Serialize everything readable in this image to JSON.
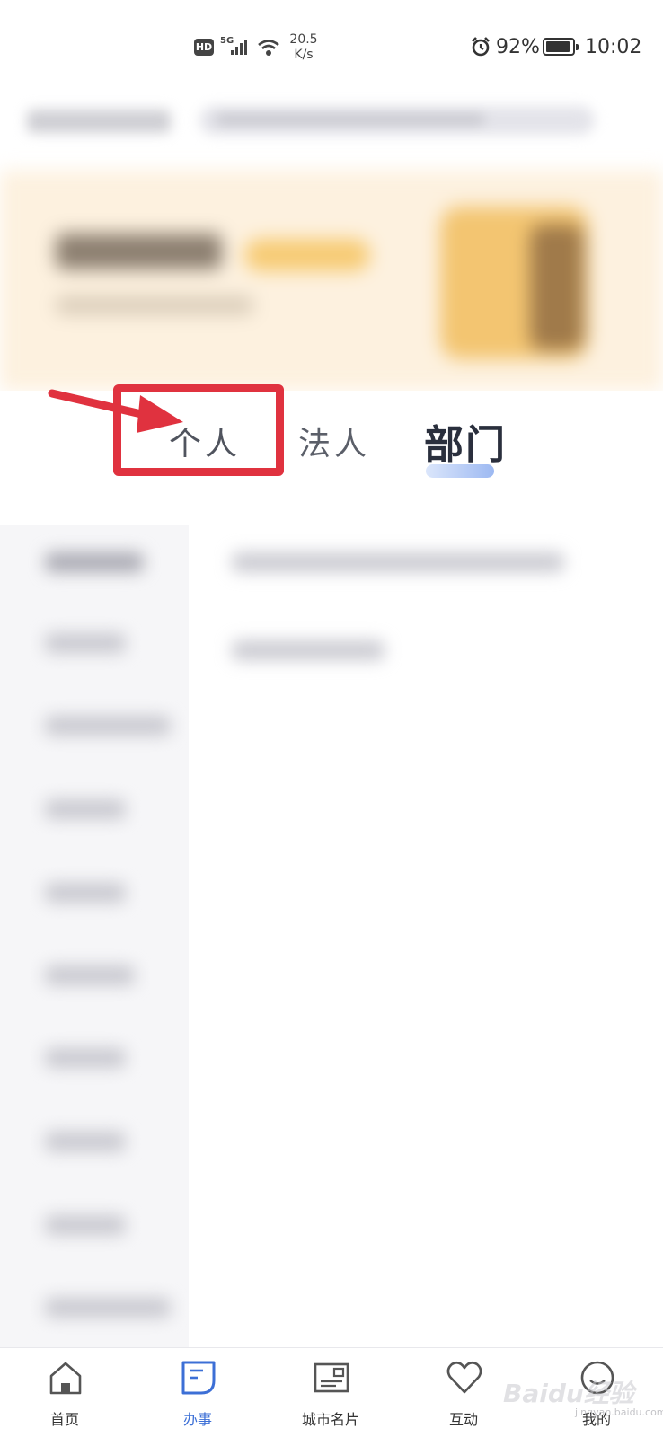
{
  "status_bar": {
    "hd_label": "HD",
    "network_label": "5G",
    "speed_value": "20.5",
    "speed_unit": "K/s",
    "battery_percent": "92%",
    "battery_level": 0.92,
    "time": "10:02",
    "icons": [
      "hd-icon",
      "signal-icon",
      "wifi-icon",
      "alarm-icon",
      "battery-icon"
    ]
  },
  "tabs": {
    "items": [
      {
        "label": "个人",
        "selected": false
      },
      {
        "label": "法人",
        "selected": false
      },
      {
        "label": "部门",
        "selected": true
      }
    ],
    "active_underline_color": "#9db9f2"
  },
  "annotation": {
    "color": "#e0323f",
    "target": "个人"
  },
  "bottom_nav": {
    "items": [
      {
        "label": "首页",
        "icon": "home-icon",
        "active": false
      },
      {
        "label": "办事",
        "icon": "document-icon",
        "active": true
      },
      {
        "label": "城市名片",
        "icon": "postcard-icon",
        "active": false
      },
      {
        "label": "互动",
        "icon": "heart-icon",
        "active": false
      },
      {
        "label": "我的",
        "icon": "smile-icon",
        "active": false
      }
    ],
    "active_color": "#3c6fd6"
  },
  "watermark": {
    "text": "Baidu经验",
    "sub": "jingyan.baidu.com"
  }
}
